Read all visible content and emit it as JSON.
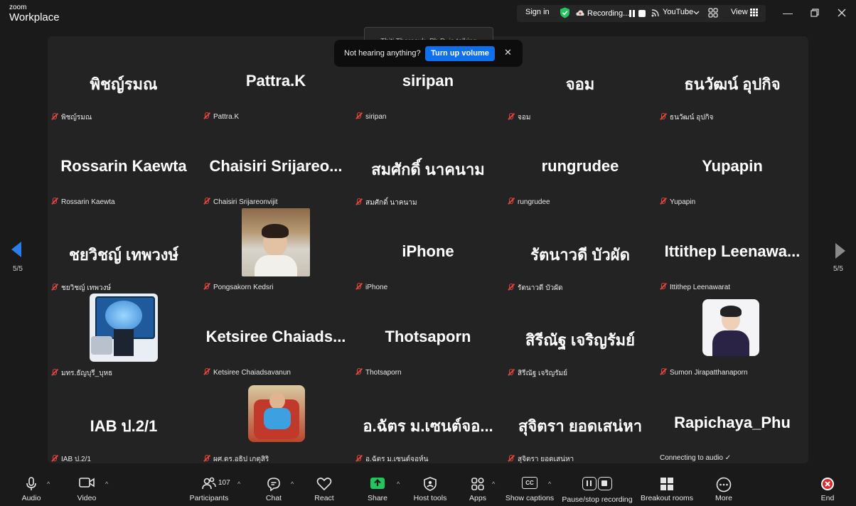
{
  "app": {
    "logo_small": "zoom",
    "logo_big": "Workplace"
  },
  "titlebar": {
    "sign_in": "Sign in",
    "recording": "Recording...",
    "youtube": "YouTube",
    "view": "View"
  },
  "talking": "Thiti Tharasuk, Ph.D. is talking",
  "toast": {
    "message": "Not hearing anything?",
    "button": "Turn up volume"
  },
  "pagination": {
    "left": "5/5",
    "right": "5/5"
  },
  "tiles": [
    {
      "display": "พิชญ์รมณ",
      "label": "พิชญ์รมณ",
      "muted": true
    },
    {
      "display": "Pattra.K",
      "label": "Pattra.K",
      "muted": true
    },
    {
      "display": "siripan",
      "label": "siripan",
      "muted": true
    },
    {
      "display": "จอม",
      "label": "จอม",
      "muted": true
    },
    {
      "display": "ธนวัฒน์  อุปกิจ",
      "label": "ธนวัฒน์ อุปกิจ",
      "muted": true
    },
    {
      "display": "Rossarin Kaewta",
      "label": "Rossarin Kaewta",
      "muted": true
    },
    {
      "display": "Chaisiri  Srijareo...",
      "label": "Chaisiri Srijareonvijit",
      "muted": true
    },
    {
      "display": "สมศักดิ์ นาคนาม",
      "label": "สมศักดิ์ นาคนาม",
      "muted": true
    },
    {
      "display": "rungrudee",
      "label": "rungrudee",
      "muted": true
    },
    {
      "display": "Yupapin",
      "label": "Yupapin",
      "muted": true
    },
    {
      "display": "ชยวิชญ์ เทพวงษ์",
      "label": "ชยวิชญ์ เทพวงษ์",
      "muted": true
    },
    {
      "display": "",
      "label": "Pongsakorn Kedsri",
      "muted": true,
      "photo": "boy"
    },
    {
      "display": "iPhone",
      "label": "iPhone",
      "muted": true
    },
    {
      "display": "รัตนาวดี บัวผัด",
      "label": "รัตนาวดี บัวผัด",
      "muted": true
    },
    {
      "display": "Ittithep  Leenawa...",
      "label": "Ittithep Leenawarat",
      "muted": true
    },
    {
      "display": "",
      "label": "มทร.ธัญบุรี_บุหธ",
      "muted": true,
      "photo": "brain"
    },
    {
      "display": "Ketsiree  Chaiads...",
      "label": "Ketsiree Chaiadsavanun",
      "muted": true
    },
    {
      "display": "Thotsaporn",
      "label": "Thotsaporn",
      "muted": true
    },
    {
      "display": "สิรีณัฐ เจริญรัมย์",
      "label": "สิรีณัฐ เจริญรัมย์",
      "muted": true
    },
    {
      "display": "",
      "label": "Sumon Jirapatthanaporn",
      "muted": true,
      "photo": "man"
    },
    {
      "display": "IAB ป.2/1",
      "label": "IAB ป.2/1",
      "muted": true
    },
    {
      "display": "",
      "label": "ผศ.ดร.อธิป เกตุสิริ",
      "muted": true,
      "photo": "kid"
    },
    {
      "display": "อ.ฉัตร ม.เซนต์จอ...",
      "label": "อ.ฉัตร ม.เซนต์จอห์น",
      "muted": true
    },
    {
      "display": "สุจิตรา ยอดเสน่หา",
      "label": "สุจิตรา ยอดเสน่หา",
      "muted": true
    },
    {
      "display": "Rapichaya_Phu",
      "label": "Connecting to audio ✓",
      "muted": false
    }
  ],
  "toolbar": {
    "audio": "Audio",
    "video": "Video",
    "participants": "Participants",
    "participants_count": "107",
    "chat": "Chat",
    "react": "React",
    "share": "Share",
    "host_tools": "Host tools",
    "apps": "Apps",
    "captions": "Show captions",
    "cc": "CC",
    "pause_recording": "Pause/stop recording",
    "breakout": "Breakout rooms",
    "more": "More",
    "end": "End"
  },
  "colors": {
    "accent": "#0e71eb",
    "share_green": "#22c55e",
    "end_red": "#e02828",
    "shield_green": "#22c55e"
  }
}
